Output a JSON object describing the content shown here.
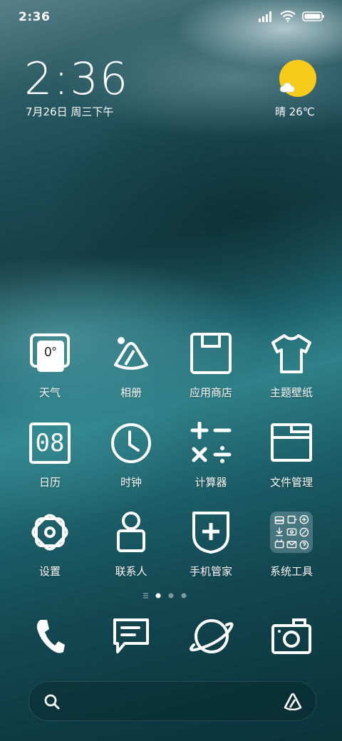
{
  "status_bar": {
    "time": "2:36"
  },
  "lockscreen_widget": {
    "time": "2:36",
    "date": "7月26日 周三下午",
    "weather": "晴 26℃"
  },
  "apps": [
    {
      "label": "天气",
      "icon": "weather-icon",
      "value": "0°"
    },
    {
      "label": "相册",
      "icon": "gallery-icon"
    },
    {
      "label": "应用商店",
      "icon": "app-store-icon"
    },
    {
      "label": "主题壁纸",
      "icon": "themes-icon"
    },
    {
      "label": "日历",
      "icon": "calendar-icon",
      "value": "08"
    },
    {
      "label": "时钟",
      "icon": "clock-icon"
    },
    {
      "label": "计算器",
      "icon": "calculator-icon"
    },
    {
      "label": "文件管理",
      "icon": "file-manager-icon"
    },
    {
      "label": "设置",
      "icon": "settings-icon"
    },
    {
      "label": "联系人",
      "icon": "contacts-icon"
    },
    {
      "label": "手机管家",
      "icon": "security-icon"
    },
    {
      "label": "系统工具",
      "icon": "system-tools-folder-icon"
    }
  ],
  "page_indicator": {
    "pages": 3,
    "current": 1
  },
  "dock": [
    {
      "name": "phone",
      "icon": "phone-icon"
    },
    {
      "name": "messages",
      "icon": "messages-icon"
    },
    {
      "name": "browser",
      "icon": "browser-icon"
    },
    {
      "name": "camera",
      "icon": "camera-icon"
    }
  ],
  "search_bar": {
    "icon": "search-icon",
    "assistant_icon": "assistant-icon"
  },
  "colors": {
    "sun": "#f6cb1a",
    "wallpaper_teal": "#1f6670"
  }
}
